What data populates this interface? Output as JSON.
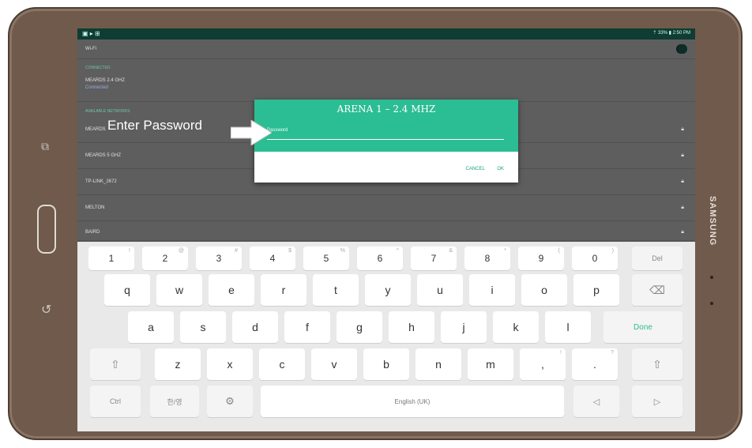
{
  "device": {
    "brand": "SAMSUNG",
    "buttons": {
      "recents_icon": "recents-icon",
      "back_icon": "back-icon",
      "home": "home-button"
    }
  },
  "status_bar": {
    "left_icons": "▣ ▸ ⊞",
    "right_text": "⇡ 33% ▮ 2:50 PM"
  },
  "wifi": {
    "header_label": "Wi-Fi",
    "connected_section": "CONNECTED",
    "connected_network": "MEARDS 2.4 GHZ",
    "connected_status": "Connected",
    "available_section": "AVAILABLE NETWORKS",
    "networks": [
      "MEARDS",
      "MEARDS 5 GHZ",
      "TP-LINK_2672",
      "MELTON",
      "BAIRD"
    ]
  },
  "dialog": {
    "title": "ARENA 1 – 2.4 MHZ",
    "password_placeholder": "Password",
    "cancel_label": "CANCEL",
    "ok_label": "OK"
  },
  "annotation": {
    "callout_text": "Enter Password"
  },
  "keyboard": {
    "row1": [
      {
        "k": "1",
        "h": "!"
      },
      {
        "k": "2",
        "h": "@"
      },
      {
        "k": "3",
        "h": "#"
      },
      {
        "k": "4",
        "h": "$"
      },
      {
        "k": "5",
        "h": "%"
      },
      {
        "k": "6",
        "h": "^"
      },
      {
        "k": "7",
        "h": "&"
      },
      {
        "k": "8",
        "h": "*"
      },
      {
        "k": "9",
        "h": "("
      },
      {
        "k": "0",
        "h": ")"
      }
    ],
    "del_label": "Del",
    "row2": [
      "q",
      "w",
      "e",
      "r",
      "t",
      "y",
      "u",
      "i",
      "o",
      "p"
    ],
    "backspace_icon": "⌫",
    "row3": [
      "a",
      "s",
      "d",
      "f",
      "g",
      "h",
      "j",
      "k",
      "l"
    ],
    "done_label": "Done",
    "row4": [
      {
        "k": "z"
      },
      {
        "k": "x"
      },
      {
        "k": "c"
      },
      {
        "k": "v"
      },
      {
        "k": "b"
      },
      {
        "k": "n"
      },
      {
        "k": "m"
      },
      {
        "k": ",",
        "h": "!"
      },
      {
        "k": ".",
        "h": "?"
      }
    ],
    "shift_icon": "⇧",
    "ctrl_label": "Ctrl",
    "lang_label": "한/영",
    "settings_icon": "⚙",
    "space_label": "English (UK)",
    "left_arrow": "◁",
    "right_arrow": "▷"
  }
}
